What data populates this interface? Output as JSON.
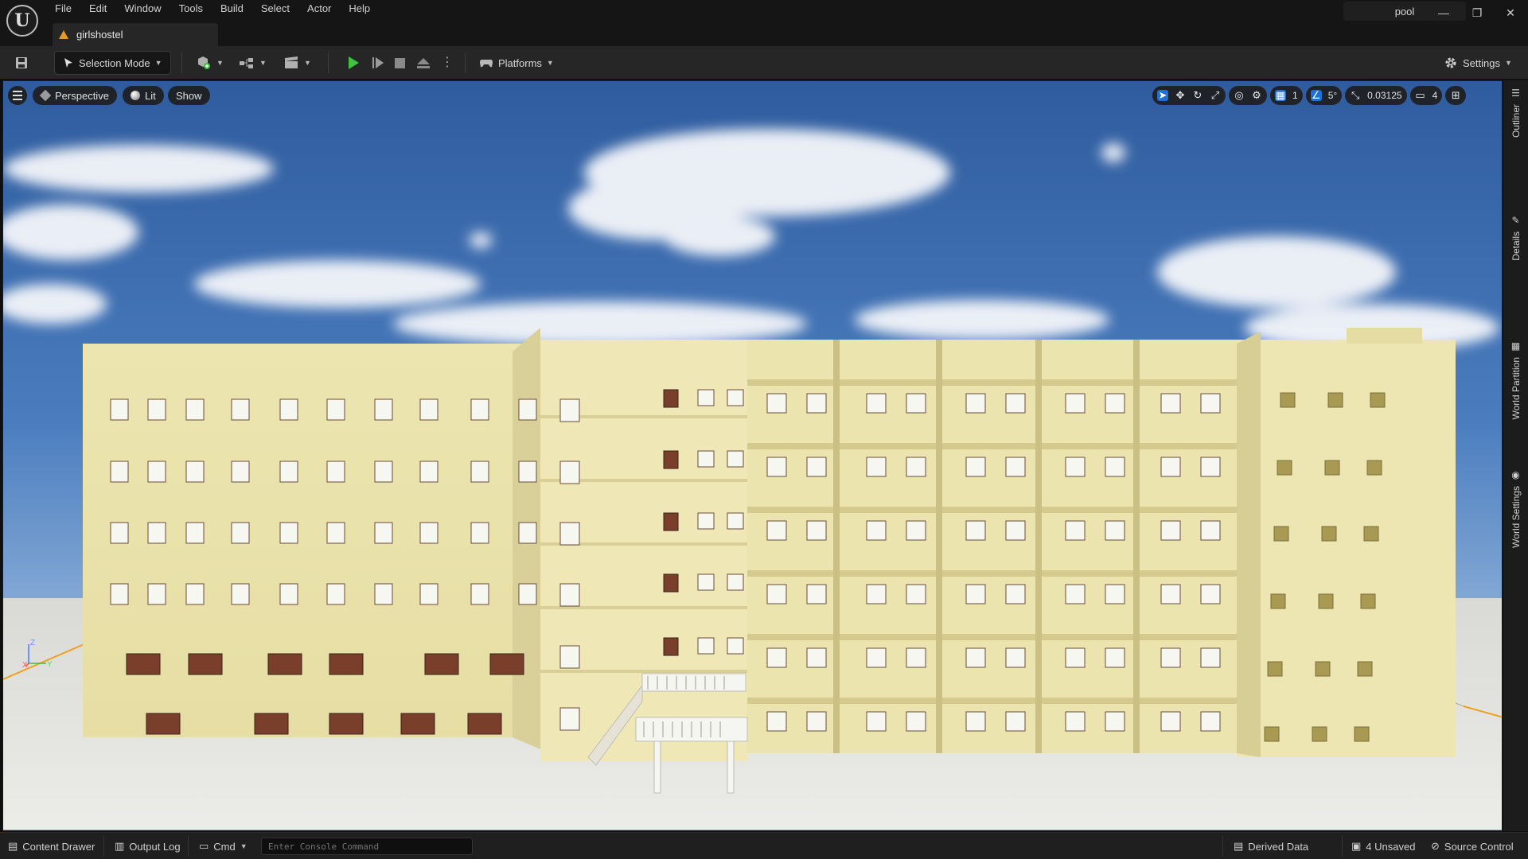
{
  "menu": {
    "items": [
      "File",
      "Edit",
      "Window",
      "Tools",
      "Build",
      "Select",
      "Actor",
      "Help"
    ]
  },
  "document_tab": {
    "label": "girlshostel"
  },
  "project_name": "pool",
  "window_controls": {
    "minimize": "—",
    "restore": "❐",
    "close": "✕"
  },
  "toolbar": {
    "selection_mode": "Selection Mode",
    "platforms": "Platforms",
    "settings": "Settings"
  },
  "viewport": {
    "perspective": "Perspective",
    "lit": "Lit",
    "show": "Show",
    "grid_size": "1",
    "rotation_snap": "5°",
    "scale_snap": "0.03125",
    "camera_speed": "4",
    "axis": {
      "z": "Z",
      "x": "X",
      "y": "Y"
    }
  },
  "side_panels": [
    "Outliner",
    "Details",
    "World Partition",
    "World Settings"
  ],
  "statusbar": {
    "content_drawer": "Content Drawer",
    "output_log": "Output Log",
    "cmd": "Cmd",
    "console_placeholder": "Enter Console Command",
    "derived_data": "Derived Data",
    "unsaved": "4 Unsaved",
    "source_control": "Source Control"
  },
  "colors": {
    "accent": "#1f6fd6",
    "play": "#3fc23f",
    "selection_outline": "#f0a020",
    "building_facade": "#efe8b6",
    "sky": "#3f6fb0"
  },
  "icons": {
    "logo": "unreal-logo-icon",
    "save": "save-icon",
    "settings": "gear-icon"
  }
}
